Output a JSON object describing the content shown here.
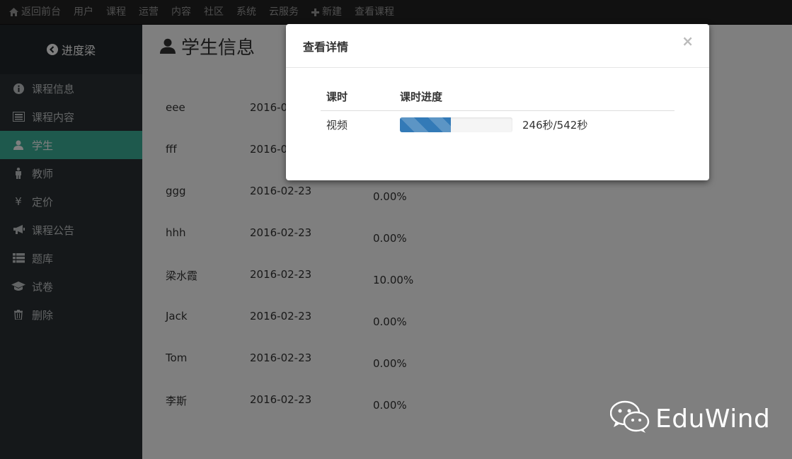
{
  "topnav": {
    "items": [
      {
        "label": "返回前台",
        "icon": "home-icon"
      },
      {
        "label": "用户"
      },
      {
        "label": "课程"
      },
      {
        "label": "运营"
      },
      {
        "label": "内容"
      },
      {
        "label": "社区"
      },
      {
        "label": "系统"
      },
      {
        "label": "云服务"
      },
      {
        "label": "新建",
        "icon": "plus-icon"
      },
      {
        "label": "查看课程"
      }
    ]
  },
  "sidebar": {
    "brand": "进度梁",
    "items": [
      {
        "label": "课程信息",
        "icon": "info-icon"
      },
      {
        "label": "课程内容",
        "icon": "list-alt-icon"
      },
      {
        "label": "学生",
        "icon": "user-icon",
        "active": true
      },
      {
        "label": "教师",
        "icon": "person-icon"
      },
      {
        "label": "定价",
        "icon": "yen-icon"
      },
      {
        "label": "课程公告",
        "icon": "bullhorn-icon"
      },
      {
        "label": "题库",
        "icon": "th-list-icon"
      },
      {
        "label": "试卷",
        "icon": "graduation-cap-icon"
      },
      {
        "label": "删除",
        "icon": "trash-icon"
      }
    ]
  },
  "main": {
    "title": "学生信息",
    "students": [
      {
        "name": "eee",
        "date": "2016-0",
        "progress": ""
      },
      {
        "name": "fff",
        "date": "2016-0",
        "progress": ""
      },
      {
        "name": "ggg",
        "date": "2016-02-23",
        "progress": "0.00%"
      },
      {
        "name": "hhh",
        "date": "2016-02-23",
        "progress": "0.00%"
      },
      {
        "name": "梁水霞",
        "date": "2016-02-23",
        "progress": "10.00%"
      },
      {
        "name": "Jack",
        "date": "2016-02-23",
        "progress": "0.00%"
      },
      {
        "name": "Tom",
        "date": "2016-02-23",
        "progress": "0.00%"
      },
      {
        "name": "李斯",
        "date": "2016-02-23",
        "progress": "0.00%"
      }
    ]
  },
  "modal": {
    "title": "查看详情",
    "close": "×",
    "headers": {
      "lesson": "课时",
      "progress": "课时进度"
    },
    "rows": [
      {
        "lesson": "视频",
        "progress_text": "246秒/542秒",
        "progress_fraction": 0.4539
      }
    ]
  },
  "watermark": {
    "text": "EduWind",
    "icon": "wechat-icon"
  },
  "colors": {
    "accent": "#3db29a",
    "progress": "#337ab7",
    "nav_bg": "#222222",
    "sidebar_bg": "#2b3134"
  }
}
